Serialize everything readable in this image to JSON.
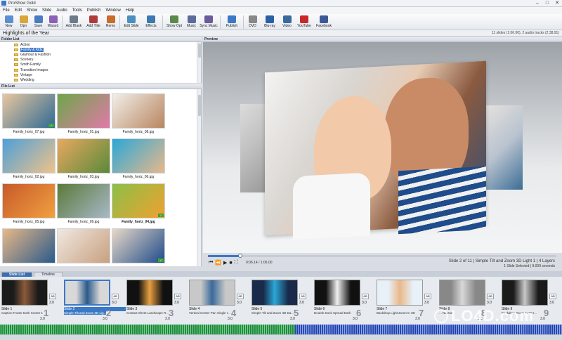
{
  "window": {
    "title": "ProShow Gold",
    "controls": [
      "–",
      "□",
      "✕"
    ]
  },
  "menu": [
    "File",
    "Edit",
    "Show",
    "Slide",
    "Audio",
    "Tools",
    "Publish",
    "Window",
    "Help"
  ],
  "toolbar": {
    "groupA": [
      {
        "label": "New",
        "icon": "new-icon",
        "color": "#5b8fd1"
      },
      {
        "label": "Opn",
        "icon": "open-icon",
        "color": "#d9a63a"
      },
      {
        "label": "Save",
        "icon": "save-icon",
        "color": "#4a7bc0"
      },
      {
        "label": "Wizard",
        "icon": "wizard-icon",
        "color": "#8c5fb8"
      }
    ],
    "groupB": [
      {
        "label": "Add Blank",
        "icon": "add-blank-icon",
        "color": "#6b7b8c"
      },
      {
        "label": "Add Title",
        "icon": "add-title-icon",
        "color": "#b03a3a"
      },
      {
        "label": "Remo",
        "icon": "remove-icon",
        "color": "#c96b2a"
      }
    ],
    "groupC": [
      {
        "label": "Edit Slide",
        "icon": "edit-slide-icon",
        "color": "#4a8fbf"
      },
      {
        "label": "Effects",
        "icon": "effects-icon",
        "color": "#3a7ab0"
      }
    ],
    "groupD": [
      {
        "label": "Show Opt",
        "icon": "show-options-icon",
        "color": "#5a8a4a"
      },
      {
        "label": "Music",
        "icon": "music-icon",
        "color": "#5b6b9c"
      },
      {
        "label": "Sync Music",
        "icon": "sync-music-icon",
        "color": "#6b5b9c"
      }
    ],
    "groupE": [
      {
        "label": "Publish",
        "icon": "publish-icon",
        "color": "#3b78c6"
      }
    ],
    "groupF": [
      {
        "label": "DVD",
        "icon": "dvd-icon",
        "color": "#888888"
      },
      {
        "label": "Blu-ray",
        "icon": "bluray-icon",
        "color": "#2a5fa8"
      },
      {
        "label": "Video",
        "icon": "video-icon",
        "color": "#3a6a9c"
      },
      {
        "label": "YouTube",
        "icon": "youtube-icon",
        "color": "#c8282a"
      },
      {
        "label": "Facebook",
        "icon": "facebook-icon",
        "color": "#3b5998"
      }
    ]
  },
  "project": {
    "title": "Highlights of the Year",
    "info": "11 slides (1:06.00), 2 audio tracks (2:38.91)"
  },
  "folder_list": {
    "header": "Folder List",
    "items": [
      {
        "label": "Action",
        "selected": false
      },
      {
        "label": "Family & Kids",
        "selected": true
      },
      {
        "label": "Glamour & Fashion",
        "selected": false
      },
      {
        "label": "Scenery",
        "selected": false
      },
      {
        "label": "Smith Family",
        "selected": false
      },
      {
        "label": "Transition Images",
        "selected": false
      },
      {
        "label": "Vintage",
        "selected": false
      },
      {
        "label": "Wedding",
        "selected": false
      }
    ]
  },
  "file_list": {
    "header": "File List",
    "files": [
      {
        "name": "Family_horiz_07.jpg",
        "bold": false,
        "used": true,
        "colors": [
          "#e9c79f",
          "#2f6a93"
        ]
      },
      {
        "name": "Family_horiz_01.jpg",
        "bold": false,
        "used": false,
        "colors": [
          "#6ea64a",
          "#e07aa8"
        ]
      },
      {
        "name": "Family_horiz_08.jpg",
        "bold": false,
        "used": false,
        "colors": [
          "#f2efe9",
          "#b88560"
        ]
      },
      {
        "name": "Family_horiz_02.jpg",
        "bold": false,
        "used": false,
        "colors": [
          "#4da0d8",
          "#f0c28a"
        ]
      },
      {
        "name": "Family_horiz_03.jpg",
        "bold": false,
        "used": false,
        "colors": [
          "#e8a860",
          "#5a8a3a"
        ]
      },
      {
        "name": "Family_horiz_06.jpg",
        "bold": false,
        "used": false,
        "colors": [
          "#2aa8d8",
          "#e8b88a"
        ]
      },
      {
        "name": "Family_horiz_05.jpg",
        "bold": false,
        "used": false,
        "colors": [
          "#c85a2a",
          "#f0a040"
        ]
      },
      {
        "name": "Family_horiz_09.jpg",
        "bold": false,
        "used": false,
        "colors": [
          "#5a7a3a",
          "#a8b8c8"
        ]
      },
      {
        "name": "Family_horiz_04.jpg",
        "bold": true,
        "used": true,
        "colors": [
          "#8ac048",
          "#f0a030"
        ]
      },
      {
        "name": "",
        "bold": false,
        "used": false,
        "colors": [
          "#e8b888",
          "#2a5a8a"
        ]
      },
      {
        "name": "",
        "bold": false,
        "used": false,
        "colors": [
          "#f0e8e0",
          "#c8a080"
        ]
      },
      {
        "name": "",
        "bold": false,
        "used": true,
        "colors": [
          "#e8d8c8",
          "#1f4c8a"
        ]
      }
    ]
  },
  "preview": {
    "header": "Preview"
  },
  "transport": {
    "buttons": [
      {
        "name": "prev-button",
        "glyph": "⏮"
      },
      {
        "name": "rewind-button",
        "glyph": "⏪"
      },
      {
        "name": "play-button",
        "glyph": "▶"
      },
      {
        "name": "stop-button",
        "glyph": "■"
      },
      {
        "name": "fullscreen-button",
        "glyph": "⛶"
      }
    ],
    "timecode": "0:06.14 / 1:06.00",
    "progress": 0.093
  },
  "slide_info": {
    "line1": "Slide 2 of 11  |  Simple Tilt and Zoom 3D Light 1  |  4 Layers",
    "line2": "1 Slide Selected  |  9.000 seconds"
  },
  "tabs": [
    {
      "label": "Slide List",
      "active": true
    },
    {
      "label": "Timeline",
      "active": false
    }
  ],
  "slides": [
    {
      "name": "Slide 1",
      "desc": "Caption Footer Dark Center 1",
      "num": "1",
      "dur": "3.0",
      "trans": "3.0",
      "selected": false,
      "colors": [
        "#1a1a1a",
        "#8a5a3a"
      ]
    },
    {
      "name": "Slide 2",
      "desc": "Simple Tilt and Zoom 3D Lig...",
      "num": "2",
      "dur": "3.0",
      "trans": "3.0",
      "selected": true,
      "colors": [
        "#d8d8d8",
        "#2a5a8a"
      ]
    },
    {
      "name": "Slide 3",
      "desc": "Contact Sheet Landscape R...",
      "num": "3",
      "dur": "3.0",
      "trans": "3.0",
      "selected": false,
      "colors": [
        "#111111",
        "#e8a040"
      ]
    },
    {
      "name": "Slide 4",
      "desc": "Vertical Center Pan Single I...",
      "num": "4",
      "dur": "3.0",
      "trans": "3.0",
      "selected": false,
      "colors": [
        "#c8c8c8",
        "#3a6a9a"
      ]
    },
    {
      "name": "Slide 5",
      "desc": "Simple Tilt and Zoom 3D Da...",
      "num": "5",
      "dur": "3.0",
      "trans": "3.0",
      "selected": false,
      "colors": [
        "#1a2a4a",
        "#2aa8d8"
      ]
    },
    {
      "name": "Slide 6",
      "desc": "Double Dock Spread Dark",
      "num": "6",
      "dur": "3.0",
      "trans": "3.0",
      "selected": false,
      "colors": [
        "#111111",
        "#f0f0f0"
      ]
    },
    {
      "name": "Slide 7",
      "desc": "Backdrop Light Zoom In 3D",
      "num": "7",
      "dur": "3.0",
      "trans": "3.0",
      "selected": false,
      "colors": [
        "#e8f0f8",
        "#e8b888"
      ]
    },
    {
      "name": "Slide 8",
      "desc": "... Neutral",
      "num": "8",
      "dur": "3.0",
      "trans": "3.0",
      "selected": false,
      "colors": [
        "#888888",
        "#d8d8d8"
      ]
    },
    {
      "name": "Slide 9",
      "desc": "Backdrop Zoom In 3D I...",
      "num": "9",
      "dur": "3.0",
      "trans": "3.0",
      "selected": false,
      "colors": [
        "#1a1a1a",
        "#c8c8c8"
      ]
    }
  ],
  "watermark": {
    "text": "LO4D.com"
  }
}
